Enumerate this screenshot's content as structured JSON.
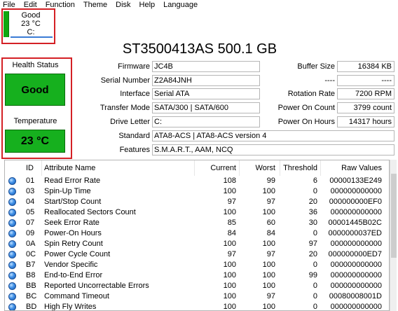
{
  "menu": [
    "File",
    "Edit",
    "Function",
    "Theme",
    "Disk",
    "Help",
    "Language"
  ],
  "drive_tab": {
    "status": "Good",
    "temp": "23 °C",
    "letter": "C:",
    "color": "#0fa80f"
  },
  "model_title": "ST3500413AS 500.1 GB",
  "health": {
    "status_label": "Health Status",
    "status_value": "Good",
    "temp_label": "Temperature",
    "temp_value": "23 °C",
    "color": "#16b01e"
  },
  "fields_left": [
    {
      "label": "Firmware",
      "value": "JC4B"
    },
    {
      "label": "Serial Number",
      "value": "Z2A84JNH"
    },
    {
      "label": "Interface",
      "value": "Serial ATA"
    },
    {
      "label": "Transfer Mode",
      "value": "SATA/300 | SATA/600"
    },
    {
      "label": "Drive Letter",
      "value": "C:"
    }
  ],
  "fields_right": [
    {
      "label": "Buffer Size",
      "value": "16384 KB"
    },
    {
      "label": "----",
      "value": "----"
    },
    {
      "label": "Rotation Rate",
      "value": "7200 RPM"
    },
    {
      "label": "Power On Count",
      "value": "3799 count"
    },
    {
      "label": "Power On Hours",
      "value": "14317 hours"
    }
  ],
  "fields_full": [
    {
      "label": "Standard",
      "value": "ATA8-ACS | ATA8-ACS version 4"
    },
    {
      "label": "Features",
      "value": "S.M.A.R.T., AAM, NCQ"
    }
  ],
  "table": {
    "headers": {
      "id": "ID",
      "name": "Attribute Name",
      "current": "Current",
      "worst": "Worst",
      "threshold": "Threshold",
      "raw": "Raw Values"
    },
    "rows": [
      {
        "id": "01",
        "name": "Read Error Rate",
        "current": "108",
        "worst": "99",
        "threshold": "6",
        "raw": "00000133E249"
      },
      {
        "id": "03",
        "name": "Spin-Up Time",
        "current": "100",
        "worst": "100",
        "threshold": "0",
        "raw": "000000000000"
      },
      {
        "id": "04",
        "name": "Start/Stop Count",
        "current": "97",
        "worst": "97",
        "threshold": "20",
        "raw": "000000000EF0"
      },
      {
        "id": "05",
        "name": "Reallocated Sectors Count",
        "current": "100",
        "worst": "100",
        "threshold": "36",
        "raw": "000000000000"
      },
      {
        "id": "07",
        "name": "Seek Error Rate",
        "current": "85",
        "worst": "60",
        "threshold": "30",
        "raw": "00001445B02C"
      },
      {
        "id": "09",
        "name": "Power-On Hours",
        "current": "84",
        "worst": "84",
        "threshold": "0",
        "raw": "0000000037ED"
      },
      {
        "id": "0A",
        "name": "Spin Retry Count",
        "current": "100",
        "worst": "100",
        "threshold": "97",
        "raw": "000000000000"
      },
      {
        "id": "0C",
        "name": "Power Cycle Count",
        "current": "97",
        "worst": "97",
        "threshold": "20",
        "raw": "000000000ED7"
      },
      {
        "id": "B7",
        "name": "Vendor Specific",
        "current": "100",
        "worst": "100",
        "threshold": "0",
        "raw": "000000000000"
      },
      {
        "id": "B8",
        "name": "End-to-End Error",
        "current": "100",
        "worst": "100",
        "threshold": "99",
        "raw": "000000000000"
      },
      {
        "id": "BB",
        "name": "Reported Uncorrectable Errors",
        "current": "100",
        "worst": "100",
        "threshold": "0",
        "raw": "000000000000"
      },
      {
        "id": "BC",
        "name": "Command Timeout",
        "current": "100",
        "worst": "97",
        "threshold": "0",
        "raw": "00080008001D"
      },
      {
        "id": "BD",
        "name": "High Fly Writes",
        "current": "100",
        "worst": "100",
        "threshold": "0",
        "raw": "000000000000"
      }
    ]
  }
}
